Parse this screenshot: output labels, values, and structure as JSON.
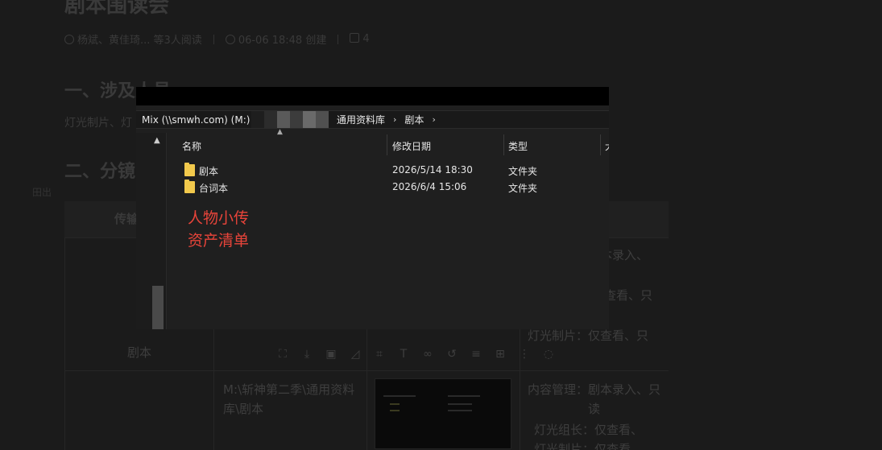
{
  "document": {
    "title": "剧本围读会",
    "meta": {
      "people": "杨斌、黄佳琦... 等3人阅读",
      "created": "06-06 18:48 创建",
      "comments": "4"
    },
    "section1": "一、涉及人员",
    "section1_text": "灯光制片、灯",
    "section2": "二、分镜",
    "small_label": "田出",
    "table": {
      "headers": [
        "传输",
        "",
        "",
        "明"
      ],
      "rows": [
        {
          "name": "",
          "path": "",
          "perm_lines": [
            "本录入、",
            "查看、只",
            "灯光制片：仅查看、只"
          ]
        },
        {
          "name": "剧本",
          "path": "",
          "perm_lines": []
        },
        {
          "name": "",
          "path": "M:\\斩神第二季\\通用资料库\\剧本",
          "perm_lines": [
            "内容管理：剧本录入、只读",
            "灯光组长：仅查看、",
            "灯光制片：仅查看"
          ]
        }
      ]
    }
  },
  "toolbar_icons": [
    "crop-icon",
    "download-icon",
    "image-icon",
    "measure-icon",
    "frame-icon",
    "text-icon",
    "link-icon",
    "undo-icon",
    "align-icon",
    "grid-icon",
    "more-icon",
    "comment-icon"
  ],
  "screenshot": {
    "address": {
      "drive": "Mix (\\\\smwh.com) (M:)",
      "crumbs": [
        "通用资料库",
        "剧本"
      ]
    },
    "columns": {
      "name": "名称",
      "date": "修改日期",
      "type": "类型",
      "size": "大"
    },
    "files": [
      {
        "name": "剧本",
        "date": "2026/5/14 18:30",
        "type": "文件夹"
      },
      {
        "name": "台词本",
        "date": "2026/6/4 15:06",
        "type": "文件夹"
      }
    ],
    "annotation": [
      "人物小传",
      "资产清单"
    ]
  },
  "colors": {
    "annotation_red": "#e8443a",
    "folder_yellow": "#f2c94c",
    "background": "#1b1b1b"
  }
}
